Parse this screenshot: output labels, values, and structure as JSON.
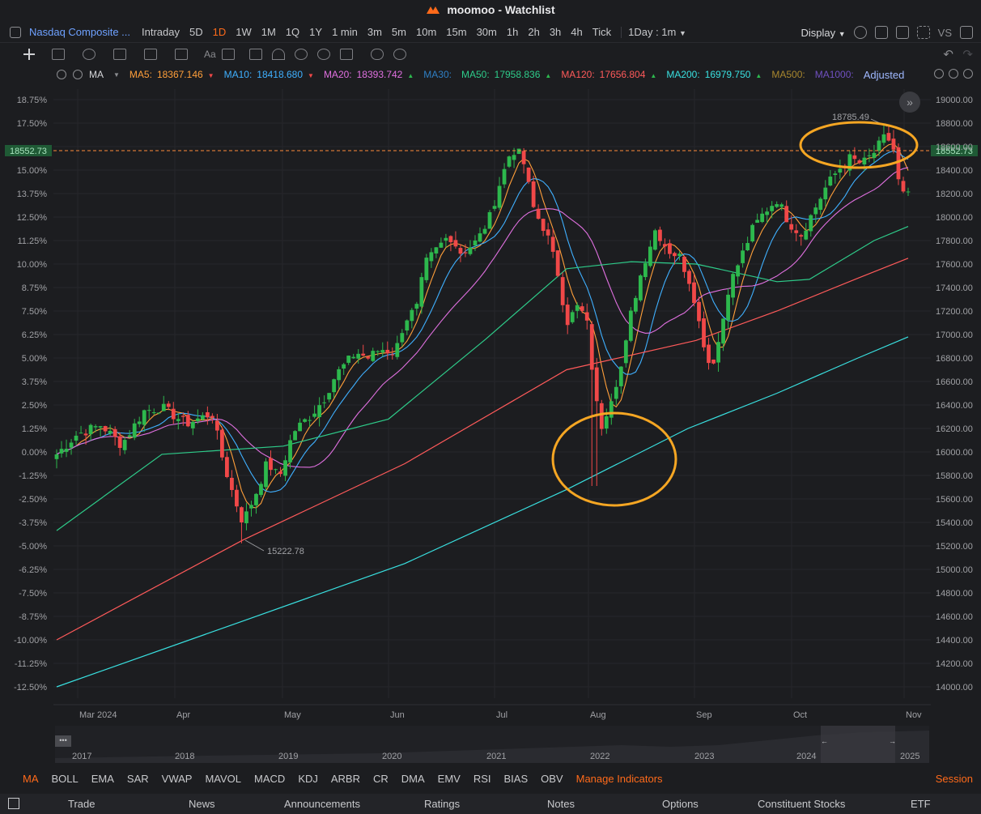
{
  "app": {
    "title": "moomoo - Watchlist"
  },
  "periods": {
    "symbol": "Nasdaq Composite ...",
    "items": [
      "Intraday",
      "5D",
      "1D",
      "1W",
      "1M",
      "1Q",
      "1Y",
      "1 min",
      "3m",
      "5m",
      "10m",
      "15m",
      "30m",
      "1h",
      "2h",
      "3h",
      "4h",
      "Tick"
    ],
    "active": "1D",
    "interval": "1Day : 1m",
    "display": "Display",
    "vs": "VS"
  },
  "ma_bar": {
    "label": "MA",
    "items": [
      {
        "name": "MA5:",
        "value": "18367.146",
        "color": "#ff9f3a",
        "dir": "down"
      },
      {
        "name": "MA10:",
        "value": "18418.680",
        "color": "#3fb0ff",
        "dir": "down"
      },
      {
        "name": "MA20:",
        "value": "18393.742",
        "color": "#e070e0",
        "dir": "up"
      },
      {
        "name": "MA30:",
        "value": "",
        "color": "#2f7fc4",
        "dir": ""
      },
      {
        "name": "MA50:",
        "value": "17958.836",
        "color": "#2ecc8a",
        "dir": "up"
      },
      {
        "name": "MA120:",
        "value": "17656.804",
        "color": "#ff5a5a",
        "dir": "up"
      },
      {
        "name": "MA200:",
        "value": "16979.750",
        "color": "#39e0e0",
        "dir": "up"
      },
      {
        "name": "MA500:",
        "value": "",
        "color": "#a8872e",
        "dir": ""
      },
      {
        "name": "MA1000:",
        "value": "",
        "color": "#7050c0",
        "dir": ""
      }
    ],
    "adjusted": "Adjusted"
  },
  "chart": {
    "pct_ticks": [
      "18.75%",
      "17.50%",
      "15.00%",
      "13.75%",
      "12.50%",
      "11.25%",
      "10.00%",
      "8.75%",
      "7.50%",
      "6.25%",
      "5.00%",
      "3.75%",
      "2.50%",
      "1.25%",
      "0.00%",
      "-1.25%",
      "-2.50%",
      "-3.75%",
      "-5.00%",
      "-6.25%",
      "-7.50%",
      "-8.75%",
      "-10.00%",
      "-11.25%",
      "-12.50%"
    ],
    "price_ticks": [
      "19000.00",
      "18800.00",
      "18600.00",
      "18400.00",
      "18200.00",
      "18000.00",
      "17800.00",
      "17600.00",
      "17400.00",
      "17200.00",
      "17000.00",
      "16800.00",
      "16600.00",
      "16400.00",
      "16200.00",
      "16000.00",
      "15800.00",
      "15600.00",
      "15400.00",
      "15200.00",
      "15000.00",
      "14800.00",
      "14600.00",
      "14400.00",
      "14200.00",
      "14000.00"
    ],
    "months": [
      "Mar 2024",
      "Apr",
      "May",
      "Jun",
      "Jul",
      "Aug",
      "Sep",
      "Oct",
      "Nov"
    ],
    "current_price": "18552.73",
    "high_label": "18785.49",
    "low_label": "15222.78"
  },
  "navigator": {
    "years": [
      "2017",
      "2018",
      "2019",
      "2020",
      "2021",
      "2022",
      "2023",
      "2024",
      "2025"
    ]
  },
  "indicators": {
    "items": [
      "MA",
      "BOLL",
      "EMA",
      "SAR",
      "VWAP",
      "MAVOL",
      "MACD",
      "KDJ",
      "ARBR",
      "CR",
      "DMA",
      "EMV",
      "RSI",
      "BIAS",
      "OBV"
    ],
    "manage": "Manage Indicators",
    "session": "Session"
  },
  "bottom_tabs": [
    "Trade",
    "News",
    "Announcements",
    "Ratings",
    "Notes",
    "Options",
    "Constituent Stocks",
    "ETF"
  ],
  "colors": {
    "up": "#2db84d",
    "down": "#f04848",
    "accent": "#ff6a1a",
    "annotation": "#f5a623"
  }
}
